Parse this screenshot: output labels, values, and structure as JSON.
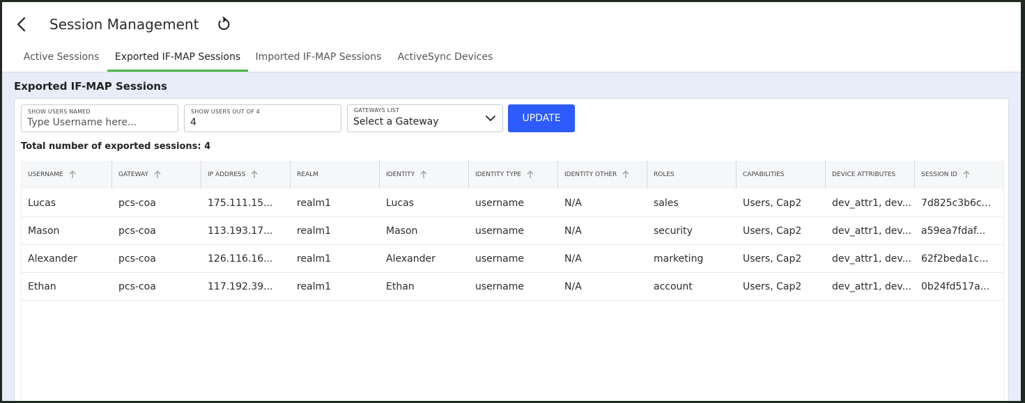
{
  "header": {
    "title": "Session Management"
  },
  "tabs": [
    {
      "label": "Active Sessions",
      "active": false
    },
    {
      "label": "Exported IF-MAP Sessions",
      "active": true
    },
    {
      "label": "Imported IF-MAP Sessions",
      "active": false
    },
    {
      "label": "ActiveSync Devices",
      "active": false
    }
  ],
  "section": {
    "title": "Exported IF-MAP Sessions"
  },
  "filters": {
    "username": {
      "label": "SHOW USERS NAMED",
      "placeholder": "Type Username here...",
      "value": ""
    },
    "count": {
      "label": "SHOW USERS OUT OF 4",
      "value": "4"
    },
    "gateway": {
      "label": "GATEWAYS LIST",
      "value": "Select a Gateway"
    },
    "update_label": "UPDATE"
  },
  "total_text": "Total number of exported sessions: 4",
  "table": {
    "columns": [
      {
        "label": "USERNAME",
        "sortable": true
      },
      {
        "label": "GATEWAY",
        "sortable": true
      },
      {
        "label": "IP ADDRESS",
        "sortable": true
      },
      {
        "label": "REALM",
        "sortable": false
      },
      {
        "label": "IDENTITY",
        "sortable": true
      },
      {
        "label": "IDENTITY TYPE",
        "sortable": true
      },
      {
        "label": "IDENTITY OTHER",
        "sortable": true
      },
      {
        "label": "ROLES",
        "sortable": false
      },
      {
        "label": "CAPABILITIES",
        "sortable": false
      },
      {
        "label": "DEVICE ATTRIBUTES",
        "sortable": false
      },
      {
        "label": "SESSION ID",
        "sortable": true
      }
    ],
    "rows": [
      [
        "Lucas",
        "pcs-coa",
        "175.111.15...",
        "realm1",
        "Lucas",
        "username",
        "N/A",
        "sales",
        "Users, Cap2",
        "dev_attr1, dev...",
        "7d825c3b6c..."
      ],
      [
        "Mason",
        "pcs-coa",
        "113.193.17...",
        "realm1",
        "Mason",
        "username",
        "N/A",
        "security",
        "Users, Cap2",
        "dev_attr1, dev...",
        "a59ea7fdaf..."
      ],
      [
        "Alexander",
        "pcs-coa",
        "126.116.16...",
        "realm1",
        "Alexander",
        "username",
        "N/A",
        "marketing",
        "Users, Cap2",
        "dev_attr1, dev...",
        "62f2beda1c..."
      ],
      [
        "Ethan",
        "pcs-coa",
        "117.192.39...",
        "realm1",
        "Ethan",
        "username",
        "N/A",
        "account",
        "Users, Cap2",
        "dev_attr1, dev...",
        "0b24fd517a..."
      ]
    ]
  },
  "colors": {
    "accent_tab": "#4bb543",
    "primary_button": "#2d5bff",
    "content_bg": "#e8edf9"
  },
  "icons": {
    "back": "chevron-left-icon",
    "refresh": "refresh-icon",
    "dropdown": "chevron-down-icon",
    "sort": "arrow-up-icon"
  }
}
